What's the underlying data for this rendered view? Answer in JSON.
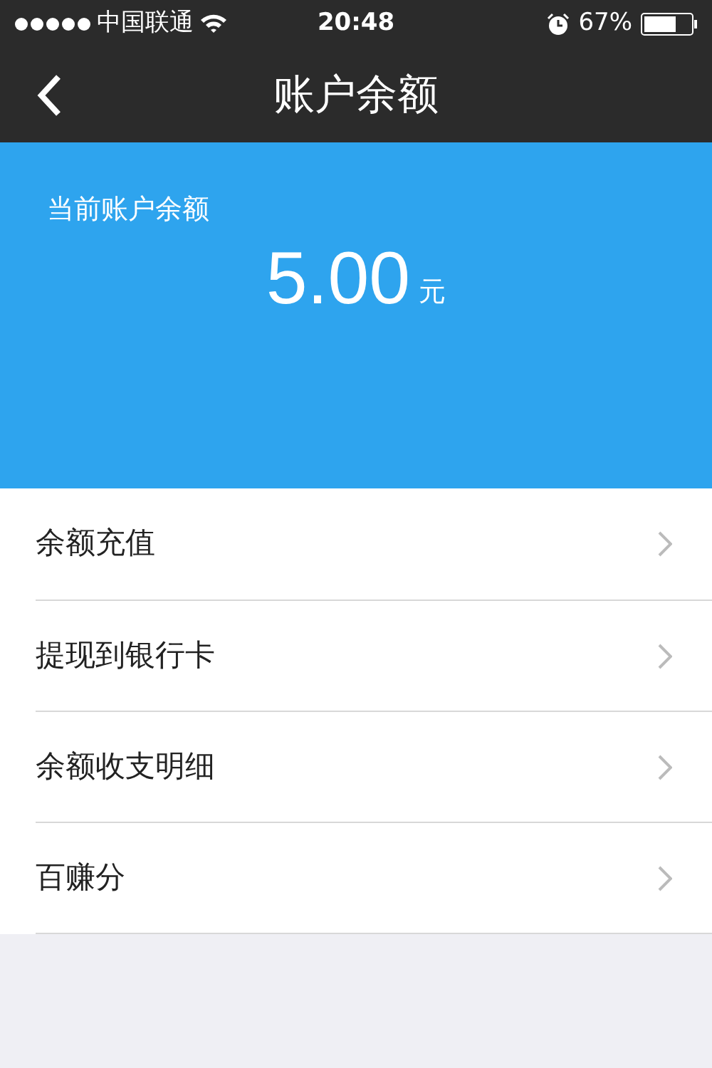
{
  "status_bar": {
    "carrier": "中国联通",
    "time": "20:48",
    "battery": "67%"
  },
  "nav": {
    "title": "账户余额"
  },
  "balance": {
    "label": "当前账户余额",
    "amount": "5.00",
    "unit": "元"
  },
  "menu": [
    {
      "label": "余额充值"
    },
    {
      "label": "提现到银行卡"
    },
    {
      "label": "余额收支明细"
    },
    {
      "label": "百赚分"
    }
  ]
}
